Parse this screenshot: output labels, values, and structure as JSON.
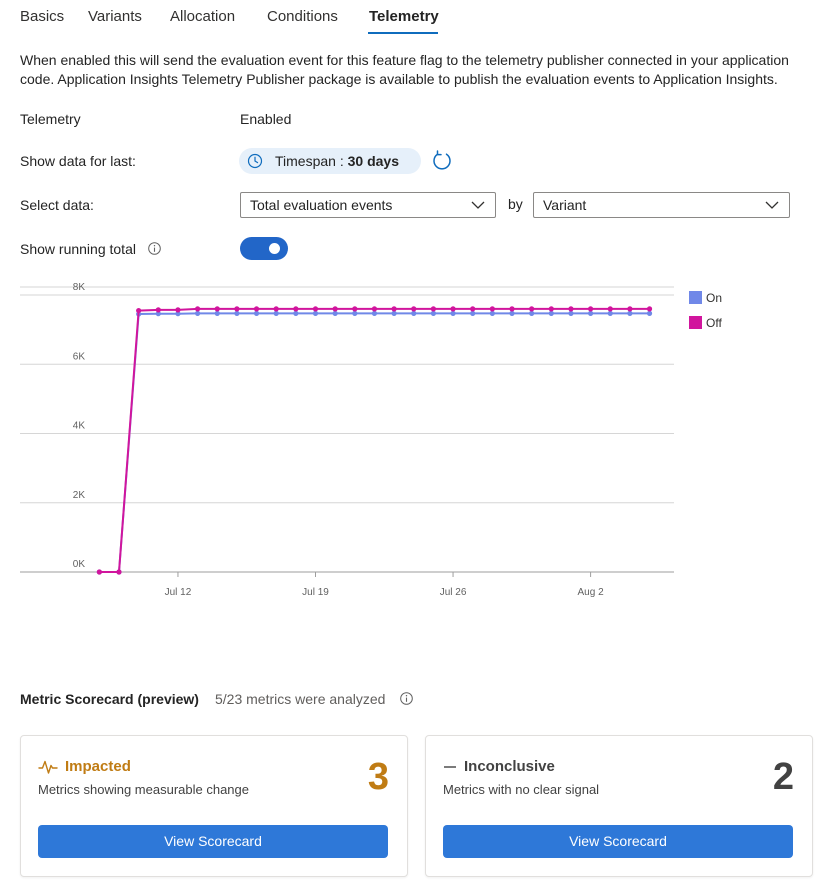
{
  "tabs": [
    {
      "label": "Basics"
    },
    {
      "label": "Variants"
    },
    {
      "label": "Allocation"
    },
    {
      "label": "Conditions"
    },
    {
      "label": "Telemetry"
    }
  ],
  "description": "When enabled this will send the evaluation event for this feature flag to the telemetry publisher connected in your application code. Application Insights Telemetry Publisher package is available to publish the evaluation events to Application Insights.",
  "telemetry": {
    "label": "Telemetry",
    "value": "Enabled"
  },
  "show_data": {
    "label": "Show data for last:",
    "timespan_prefix": "Timespan : ",
    "timespan_value": "30 days"
  },
  "select_data": {
    "label": "Select data:",
    "metric": "Total evaluation events",
    "by": "by",
    "group": "Variant"
  },
  "running_total": {
    "label": "Show running total",
    "enabled": true
  },
  "colors": {
    "on": "#7088e8",
    "off": "#d1159d",
    "accent": "#0f6cbd",
    "impacted": "#c07c14",
    "inconclusive_count": "#424242"
  },
  "chart_data": {
    "type": "line",
    "y_ticks": [
      "0K",
      "2K",
      "4K",
      "6K",
      "8K"
    ],
    "ylim": [
      0,
      8000
    ],
    "x_tick_labels": [
      "Jul 12",
      "Jul 19",
      "Jul 26",
      "Aug 2"
    ],
    "x_tick_days": [
      8,
      15,
      22,
      29
    ],
    "x_day_range": [
      1,
      31
    ],
    "legend_position": "top-right",
    "series": [
      {
        "name": "On",
        "color_key": "on",
        "days": [
          4,
          5,
          6,
          7,
          8,
          9,
          10,
          11,
          12,
          13,
          14,
          15,
          16,
          17,
          18,
          19,
          20,
          21,
          22,
          23,
          24,
          25,
          26,
          27,
          28,
          29,
          30,
          31,
          32
        ],
        "values": [
          0,
          0,
          7450,
          7460,
          7460,
          7470,
          7470,
          7470,
          7470,
          7470,
          7470,
          7470,
          7470,
          7470,
          7470,
          7470,
          7470,
          7470,
          7470,
          7470,
          7470,
          7470,
          7470,
          7470,
          7470,
          7470,
          7470,
          7470,
          7470
        ]
      },
      {
        "name": "Off",
        "color_key": "off",
        "days": [
          4,
          5,
          6,
          7,
          8,
          9,
          10,
          11,
          12,
          13,
          14,
          15,
          16,
          17,
          18,
          19,
          20,
          21,
          22,
          23,
          24,
          25,
          26,
          27,
          28,
          29,
          30,
          31,
          32
        ],
        "values": [
          0,
          0,
          7550,
          7570,
          7570,
          7600,
          7600,
          7600,
          7600,
          7600,
          7600,
          7600,
          7600,
          7600,
          7600,
          7600,
          7600,
          7600,
          7600,
          7600,
          7600,
          7600,
          7600,
          7600,
          7600,
          7600,
          7600,
          7600,
          7600
        ]
      }
    ]
  },
  "scorecard": {
    "title": "Metric Scorecard (preview)",
    "summary": "5/23 metrics were analyzed",
    "impacted": {
      "title": "Impacted",
      "subtitle": "Metrics showing measurable change",
      "count": "3",
      "button": "View Scorecard",
      "icon": "pulse-icon"
    },
    "inconclusive": {
      "title": "Inconclusive",
      "subtitle": "Metrics with no clear signal",
      "count": "2",
      "button": "View Scorecard",
      "icon": "dash-icon"
    }
  }
}
